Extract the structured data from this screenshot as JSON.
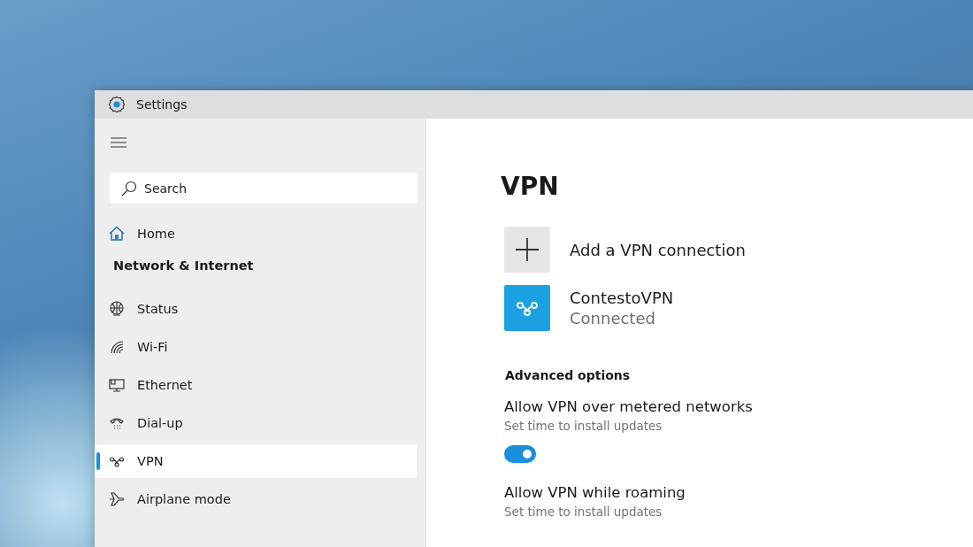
{
  "window": {
    "title": "Settings"
  },
  "sidebar": {
    "search": {
      "placeholder": "Search"
    },
    "home": "Home",
    "section": "Network & Internet",
    "items": [
      {
        "label": "Status",
        "selected": false
      },
      {
        "label": "Wi-Fi",
        "selected": false
      },
      {
        "label": "Ethernet",
        "selected": false
      },
      {
        "label": "Dial-up",
        "selected": false
      },
      {
        "label": "VPN",
        "selected": true
      },
      {
        "label": "Airplane mode",
        "selected": false
      }
    ]
  },
  "content": {
    "title": "VPN",
    "add_connection": "Add a VPN connection",
    "connections": [
      {
        "name": "ContestoVPN",
        "status": "Connected"
      }
    ],
    "advanced_heading": "Advanced options",
    "options": [
      {
        "title": "Allow VPN over metered networks",
        "subtitle": "Set time to install updates",
        "on": true
      },
      {
        "title": "Allow VPN while roaming",
        "subtitle": "Set time to install updates"
      }
    ]
  }
}
